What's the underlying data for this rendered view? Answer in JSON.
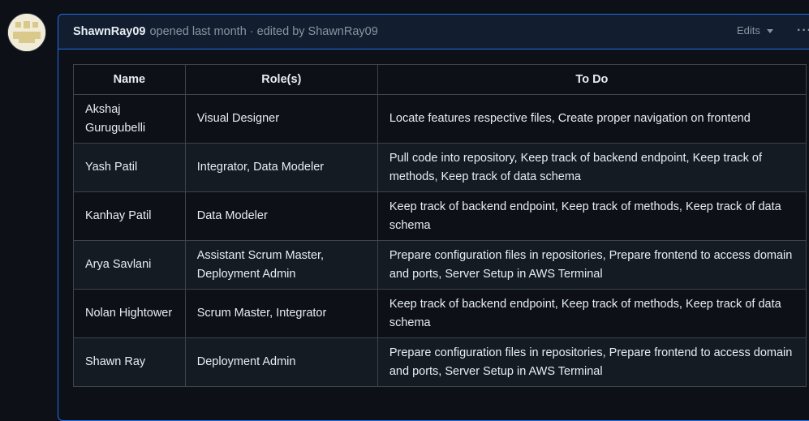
{
  "comment": {
    "author": "ShawnRay09",
    "meta": "opened last month · edited by ShawnRay09",
    "edits_label": "Edits",
    "more_icon": "kebab-horizontal-icon",
    "avatar_icon": "identicon-avatar"
  },
  "table": {
    "headers": [
      "Name",
      "Role(s)",
      "To Do"
    ],
    "rows": [
      {
        "name": "Akshaj Gurugubelli",
        "roles": "Visual Designer",
        "todo": "Locate features respective files, Create proper navigation on frontend"
      },
      {
        "name": "Yash Patil",
        "roles": "Integrator, Data Modeler",
        "todo": "Pull code into repository, Keep track of backend endpoint, Keep track of methods, Keep track of data schema"
      },
      {
        "name": "Kanhay Patil",
        "roles": "Data Modeler",
        "todo": "Keep track of backend endpoint, Keep track of methods, Keep track of data schema"
      },
      {
        "name": "Arya Savlani",
        "roles": "Assistant Scrum Master, Deployment Admin",
        "todo": "Prepare configuration files in repositories, Prepare frontend to access domain and ports, Server Setup in AWS Terminal"
      },
      {
        "name": "Nolan Hightower",
        "roles": "Scrum Master, Integrator",
        "todo": "Keep track of backend endpoint, Keep track of methods, Keep track of data schema"
      },
      {
        "name": "Shawn Ray",
        "roles": "Deployment Admin",
        "todo": "Prepare configuration files in repositories, Prepare frontend to access domain and ports, Server Setup in AWS Terminal"
      }
    ]
  },
  "colors": {
    "background": "#0d1117",
    "header_background": "#121d2f",
    "comment_border": "#1f6feb",
    "table_border": "#3d444d",
    "muted_text": "#8b949e"
  }
}
